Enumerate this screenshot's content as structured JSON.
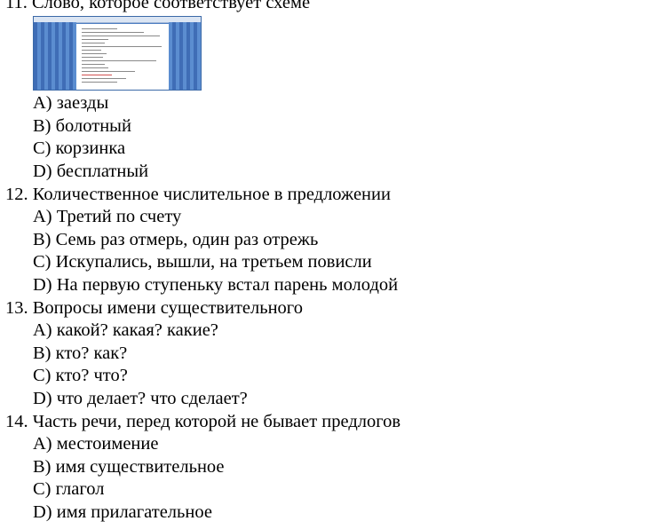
{
  "questions": [
    {
      "title": "11. Слово, которое соответствует схеме",
      "options": [
        "А) заезды",
        "В) болотный",
        "С) корзинка",
        "D) бесплатный"
      ]
    },
    {
      "title": "12. Количественное числительное в предложении",
      "options": [
        "А) Третий по счету",
        "В) Семь раз отмерь, один раз отрежь",
        "С) Искупались, вышли, на третьем повисли",
        "D) На первую ступеньку встал парень молодой"
      ]
    },
    {
      "title": "13. Вопросы имени существительного",
      "options": [
        "А) какой? какая? какие?",
        "В) кто? как?",
        "С) кто? что?",
        "D) что делает? что сделает?"
      ]
    },
    {
      "title": "14. Часть речи, перед которой не бывает предлогов",
      "options": [
        "А) местоимение",
        "В) имя существительное",
        "С) глагол",
        "D) имя прилагательное"
      ]
    }
  ]
}
